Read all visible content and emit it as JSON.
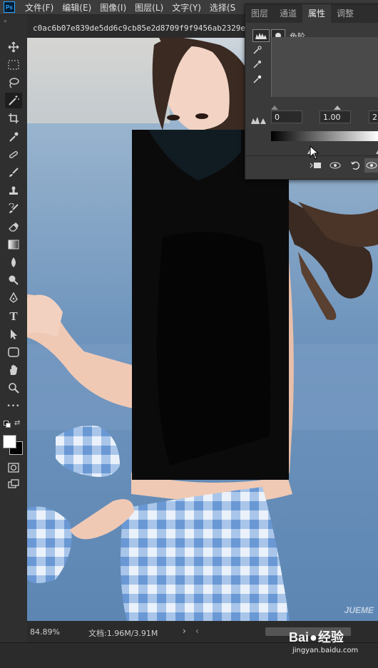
{
  "app": {
    "logo": "Ps"
  },
  "menu": [
    "文件(F)",
    "编辑(E)",
    "图像(I)",
    "图层(L)",
    "文字(Y)",
    "选择(S"
  ],
  "document": {
    "tab_title": "c0ac6b07e839de5dd6c9cb85e2d8709f9f9456ab2329e"
  },
  "tools": [
    "move-icon",
    "marquee-icon",
    "lasso-icon",
    "magic-wand-icon",
    "crop-icon",
    "eyedropper-icon",
    "healing-icon",
    "brush-icon",
    "stamp-icon",
    "history-brush-icon",
    "eraser-icon",
    "gradient-icon",
    "blur-icon",
    "dodge-icon",
    "pen-icon",
    "type-icon",
    "path-select-icon",
    "shape-icon",
    "hand-icon",
    "zoom-icon",
    "more-icon"
  ],
  "tool_labels": {
    "type": "T",
    "more": "•••"
  },
  "panel": {
    "tabs": [
      "图层",
      "通道",
      "属性",
      "调整"
    ],
    "active_tab": "属性",
    "adjustment_label": "色阶",
    "levels_inputs": [
      "0",
      "1.00",
      "2"
    ]
  },
  "status": {
    "zoom": "84.89%",
    "doc_info": "文档:1.96M/3.91M",
    "arrow": "›",
    "scroll_left": "‹"
  },
  "watermark": {
    "brand": "Bai",
    "brand2": "经验",
    "url": "jingyan.baidu.com",
    "photo_mark": "JUEME"
  },
  "colors": {
    "accent": "#31a8ff",
    "panel_bg": "#3a3a3a",
    "ui_bg": "#2b2b2b"
  }
}
